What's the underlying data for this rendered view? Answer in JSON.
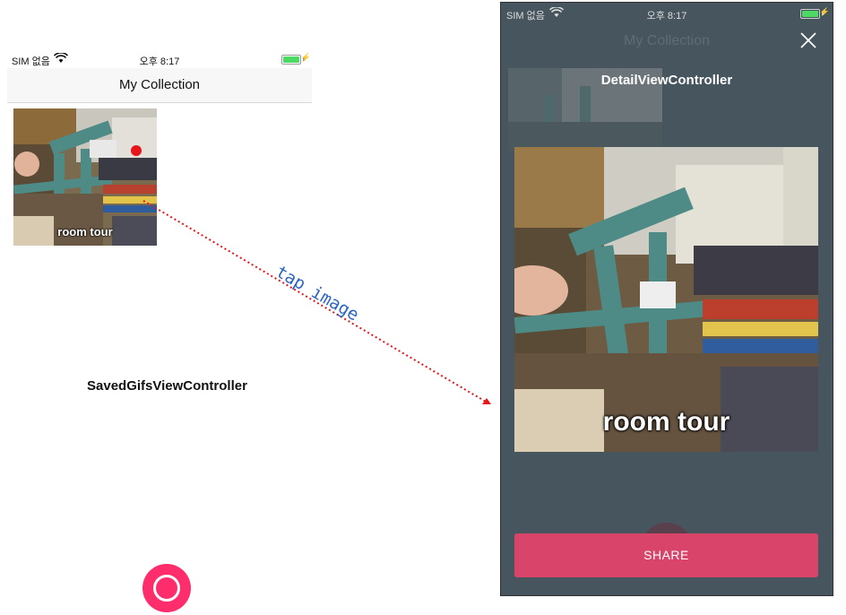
{
  "left": {
    "status": {
      "carrier": "SIM 없음",
      "time": "오후 8:17"
    },
    "nav_title": "My Collection",
    "item_caption": "room tour",
    "controller_label": "SavedGifsViewController"
  },
  "annotation": {
    "text": "tap image"
  },
  "right": {
    "status": {
      "carrier": "SIM 없음",
      "time": "오후 8:17"
    },
    "nav_title": "My Collection",
    "controller_label": "DetailViewController",
    "gif_caption": "room tour",
    "share_label": "SHARE"
  },
  "colors": {
    "record_button": "#ff2d6b",
    "share_button": "#d8446a",
    "detail_background": "#46555e",
    "annotation_line": "#e8141b",
    "annotation_text": "#2b64c4"
  }
}
